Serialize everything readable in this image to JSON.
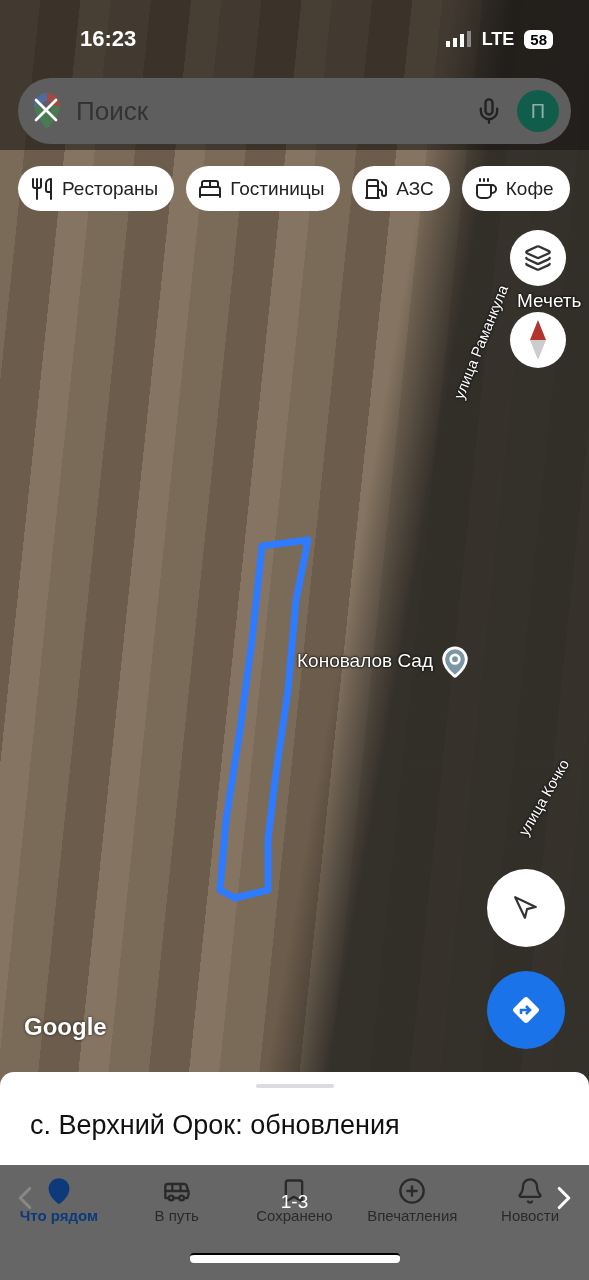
{
  "status_bar": {
    "time": "16:23",
    "network": "LTE",
    "battery": "58"
  },
  "search": {
    "placeholder": "Поиск",
    "avatar": "П"
  },
  "chips": [
    {
      "label": "Рестораны",
      "kind": "restaurant"
    },
    {
      "label": "Гостиницы",
      "kind": "hotel"
    },
    {
      "label": "АЗС",
      "kind": "fuel"
    },
    {
      "label": "Кофе",
      "kind": "coffee"
    }
  ],
  "map_labels": [
    {
      "text": "Мечеть",
      "kind": "place"
    },
    {
      "text": "улица Раманкула",
      "kind": "street"
    },
    {
      "text": "Коновалов Сад",
      "kind": "pin"
    },
    {
      "text": "улица Кочко",
      "kind": "street"
    }
  ],
  "map": {
    "attribution": "Google"
  },
  "sheet": {
    "title": "с. Верхний Орок: обновления"
  },
  "nav": [
    {
      "label": "Что рядом",
      "kind": "explore",
      "selected": true
    },
    {
      "label": "В путь",
      "kind": "commute",
      "selected": false
    },
    {
      "label": "Сохранено",
      "kind": "saved",
      "selected": false
    },
    {
      "label": "Впечатления",
      "kind": "contribute",
      "selected": false
    },
    {
      "label": "Новости",
      "kind": "updates",
      "selected": false
    }
  ],
  "viewer": {
    "counter": "1-3"
  }
}
